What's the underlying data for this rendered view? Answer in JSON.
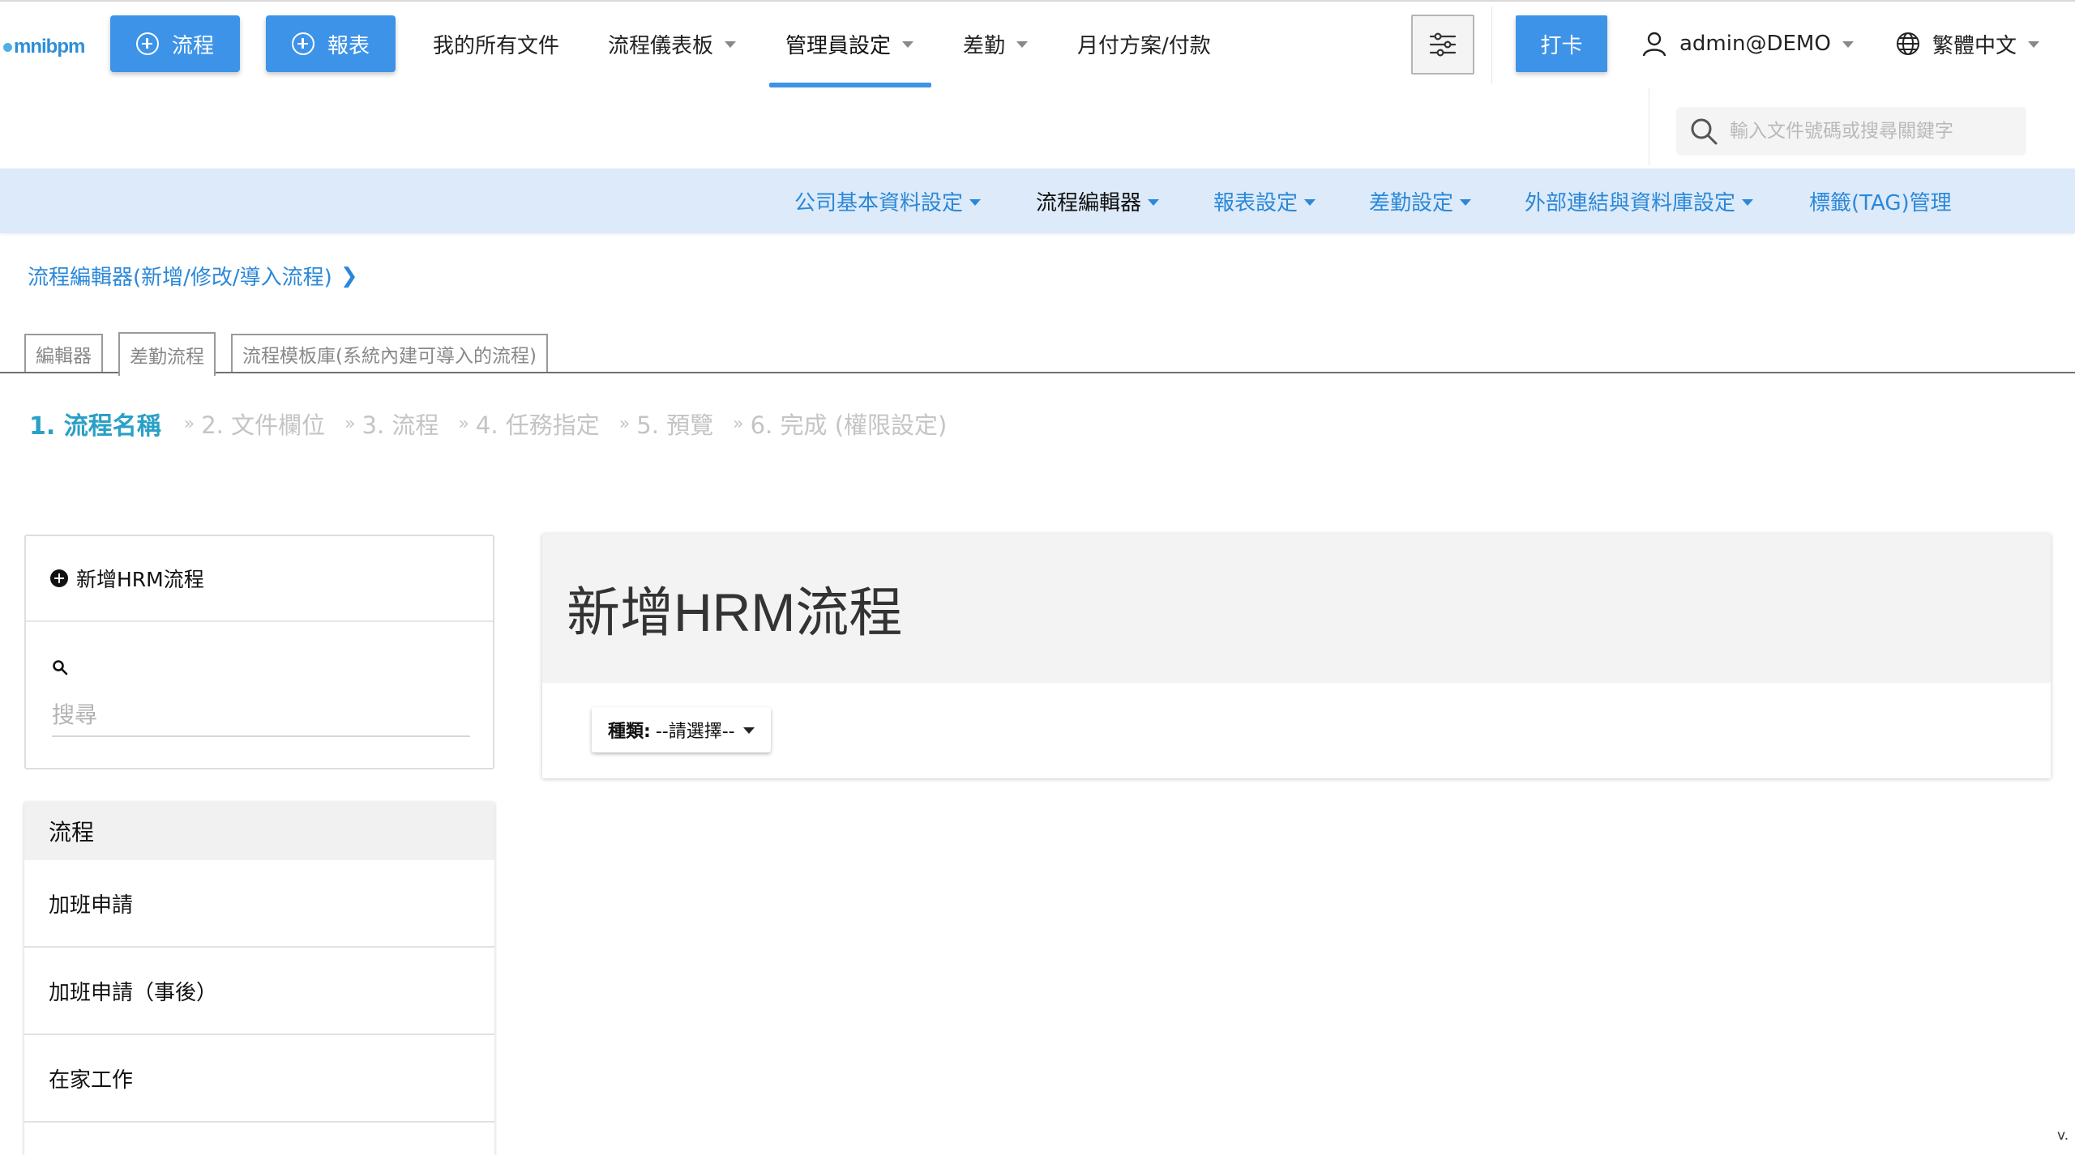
{
  "brand": {
    "logo_text": "mnibpm"
  },
  "topnav": {
    "new_flow_label": "流程",
    "new_report_label": "報表",
    "items": [
      {
        "label": "我的所有文件",
        "has_caret": false
      },
      {
        "label": "流程儀表板",
        "has_caret": true
      },
      {
        "label": "管理員設定",
        "has_caret": true,
        "active": true
      },
      {
        "label": "差勤",
        "has_caret": true
      },
      {
        "label": "月付方案/付款",
        "has_caret": false
      }
    ],
    "settings_icon": "sliders-icon",
    "punch_label": "打卡",
    "user_label": "admin@DEMO",
    "language_label": "繁體中文",
    "search_placeholder": "輸入文件號碼或搜尋關鍵字"
  },
  "subnav": {
    "items": [
      {
        "label": "公司基本資料設定",
        "has_caret": true
      },
      {
        "label": "流程編輯器",
        "has_caret": true,
        "active": true
      },
      {
        "label": "報表設定",
        "has_caret": true
      },
      {
        "label": "差勤設定",
        "has_caret": true
      },
      {
        "label": "外部連結與資料庫設定",
        "has_caret": true
      },
      {
        "label": "標籤(TAG)管理",
        "has_caret": false
      }
    ]
  },
  "breadcrumb": {
    "label": "流程編輯器(新增/修改/導入流程)",
    "chevron": "❯"
  },
  "tabs": [
    {
      "label": "編輯器"
    },
    {
      "label": "差勤流程",
      "active": true
    },
    {
      "label": "流程模板庫(系統內建可導入的流程)"
    }
  ],
  "steps": {
    "active": "1.  流程名稱",
    "separator": "»",
    "items": [
      "2. 文件欄位",
      "3. 流程",
      "4. 任務指定",
      "5. 預覽",
      "6. 完成 (權限設定)"
    ]
  },
  "sidebar": {
    "add_label": "新增HRM流程",
    "search_placeholder": "搜尋",
    "list_header": "流程",
    "items": [
      "加班申請",
      "加班申請（事後）",
      "在家工作"
    ]
  },
  "main": {
    "title": "新增HRM流程",
    "type_label": "種類:",
    "type_value": "--請選擇--"
  },
  "footer": {
    "version": "v."
  },
  "colors": {
    "primary": "#3d93e8",
    "link": "#2b88d8",
    "step_active": "#2ba0c6",
    "subnav_bg": "#ddeaf9"
  }
}
